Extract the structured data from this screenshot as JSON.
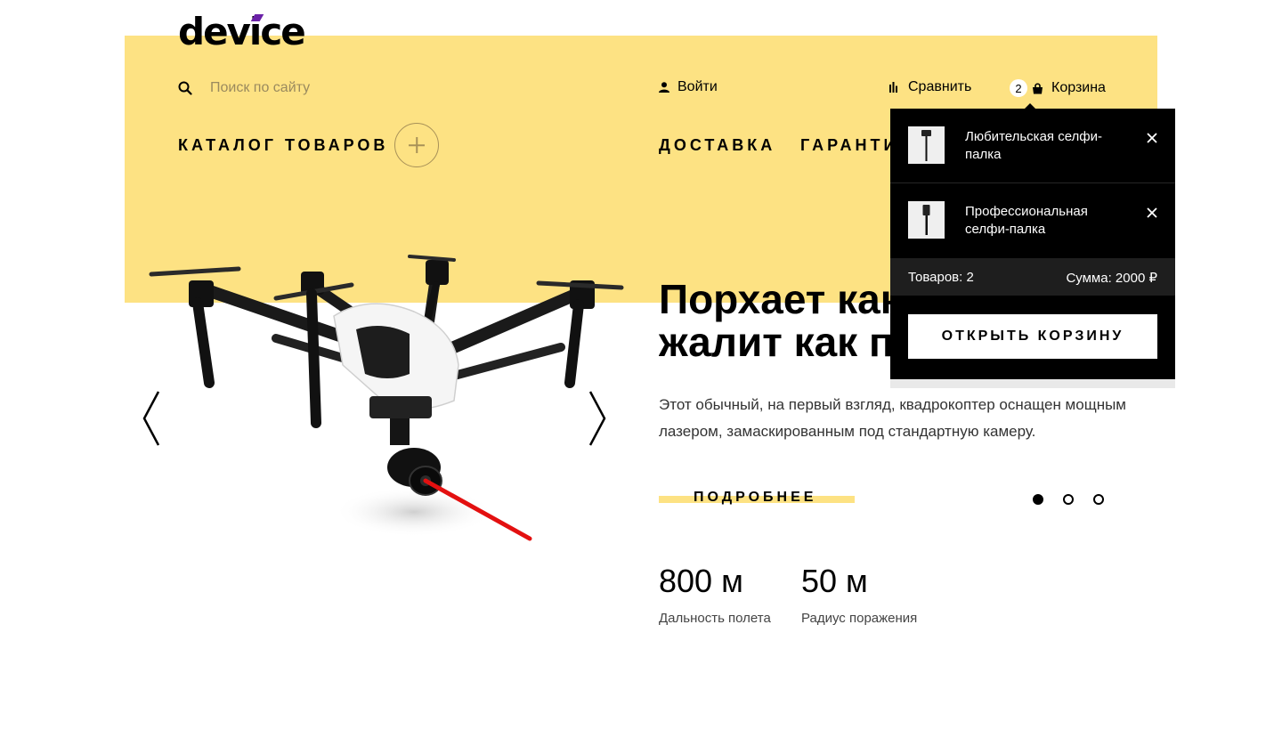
{
  "header": {
    "logo": "device",
    "search": {
      "placeholder": "Поиск по сайту",
      "icon": "search-icon"
    },
    "login_label": "Войти",
    "compare_label": "Сравнить",
    "cart": {
      "count": "2",
      "label": "Корзина"
    }
  },
  "nav": {
    "catalog_label": "КАТАЛОГ ТОВАРОВ",
    "delivery_label": "ДОСТАВКА",
    "warranty_label": "ГАРАНТИЯ"
  },
  "cart_popup": {
    "items": [
      {
        "name": "Любительская селфи-палка"
      },
      {
        "name": "Профессиональная селфи-палка"
      }
    ],
    "summary_count": "Товаров: 2",
    "summary_total": "Сумма: 2000 ₽",
    "open_button": "ОТКРЫТЬ КОРЗИНУ"
  },
  "hero": {
    "title_line1": "Порхает как бабочка,",
    "title_line2": "жалит как пчела",
    "description": "Этот обычный, на первый взгляд, квадрокоптер оснащен мощным лазером, замаскированным под стандартную камеру.",
    "more_label": "ПОДРОБНЕЕ",
    "slides_total": 3,
    "active_slide": 1
  },
  "stats": [
    {
      "value": "800 м",
      "label": "Дальность полета"
    },
    {
      "value": "50 м",
      "label": "Радиус поражения"
    }
  ],
  "colors": {
    "accent_yellow": "#fde283",
    "popup_background": "#000000",
    "laser": "#e31010"
  }
}
